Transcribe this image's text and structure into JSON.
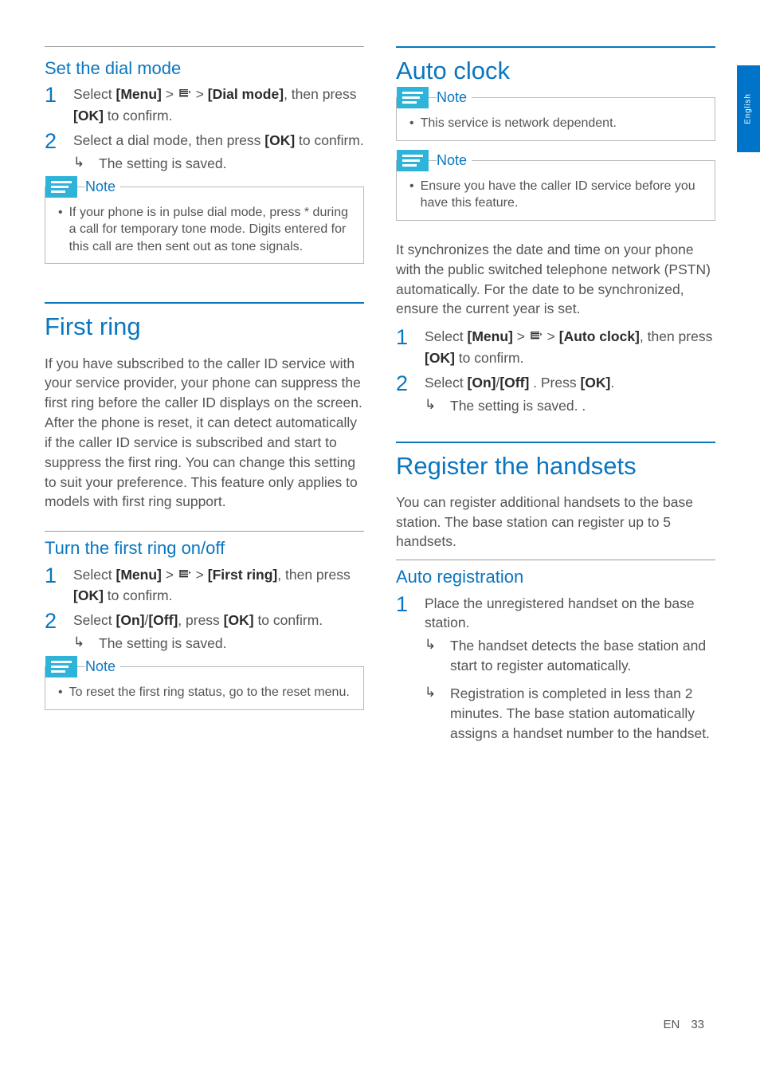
{
  "tab": {
    "lang": "English"
  },
  "footer": {
    "lang": "EN",
    "page": "33"
  },
  "left": {
    "dial": {
      "heading": "Set the dial mode",
      "step1_pre": "Select ",
      "step1_menu": "[Menu]",
      "step1_sep1": " > ",
      "step1_sep2": " > ",
      "step1_target": "[Dial mode]",
      "step1_post": ", then press ",
      "step1_ok": "[OK]",
      "step1_tail": " to confirm.",
      "step2_pre": "Select a dial mode, then press ",
      "step2_ok": "[OK]",
      "step2_tail": " to confirm.",
      "result": "The setting is saved.",
      "note_label": "Note",
      "note_body": "If your phone is in pulse dial mode, press * during a call for temporary tone mode. Digits entered for this call are then sent out as tone signals."
    },
    "firstring": {
      "heading": "First ring",
      "para": "If you have subscribed to the caller ID service with your service provider, your phone can suppress the first ring before the caller ID displays on the screen. After the phone is reset, it can detect automatically if the caller ID service is subscribed and start to suppress the first ring. You can change this setting to suit your preference. This feature only applies to models with first ring support.",
      "sub": "Turn the first ring on/off",
      "step1_pre": "Select ",
      "step1_menu": "[Menu]",
      "step1_sep1": " > ",
      "step1_sep2": " > ",
      "step1_target": "[First ring]",
      "step1_post": ", then press ",
      "step1_ok": "[OK]",
      "step1_tail": " to confirm.",
      "step2_pre": "Select ",
      "step2_on": "[On]",
      "step2_slash": "/",
      "step2_off": "[Off]",
      "step2_mid": ", press ",
      "step2_ok": "[OK]",
      "step2_tail": " to confirm.",
      "result": "The setting is saved.",
      "note_label": "Note",
      "note_body": "To reset the first ring status, go to the reset menu."
    }
  },
  "right": {
    "autoclock": {
      "heading": "Auto clock",
      "note1_label": "Note",
      "note1_body": "This service is network dependent.",
      "note2_label": "Note",
      "note2_body": "Ensure you have the caller ID service before you have this feature.",
      "para": "It synchronizes the date and time on your phone with the public switched telephone network (PSTN) automatically. For the date to be synchronized, ensure the current year is set.",
      "step1_pre": "Select ",
      "step1_menu": "[Menu]",
      "step1_sep1": " > ",
      "step1_sep2": " > ",
      "step1_target": "[Auto clock]",
      "step1_post": ", then press ",
      "step1_ok": "[OK]",
      "step1_tail": " to confirm.",
      "step2_pre": "Select ",
      "step2_on": "[On]",
      "step2_slash": "/",
      "step2_off": "[Off]",
      "step2_mid": " . Press ",
      "step2_ok": "[OK]",
      "step2_tail": ".",
      "result": "The setting is saved. ."
    },
    "register": {
      "heading": "Register the handsets",
      "para": "You can register additional handsets to the base station. The base station can register up to 5 handsets.",
      "sub": "Auto registration",
      "step1": "Place the unregistered handset on the base station.",
      "result1": "The handset detects the base station and start to register automatically.",
      "result2": "Registration is completed in less than 2 minutes. The base station automatically assigns a handset number to the handset."
    }
  }
}
